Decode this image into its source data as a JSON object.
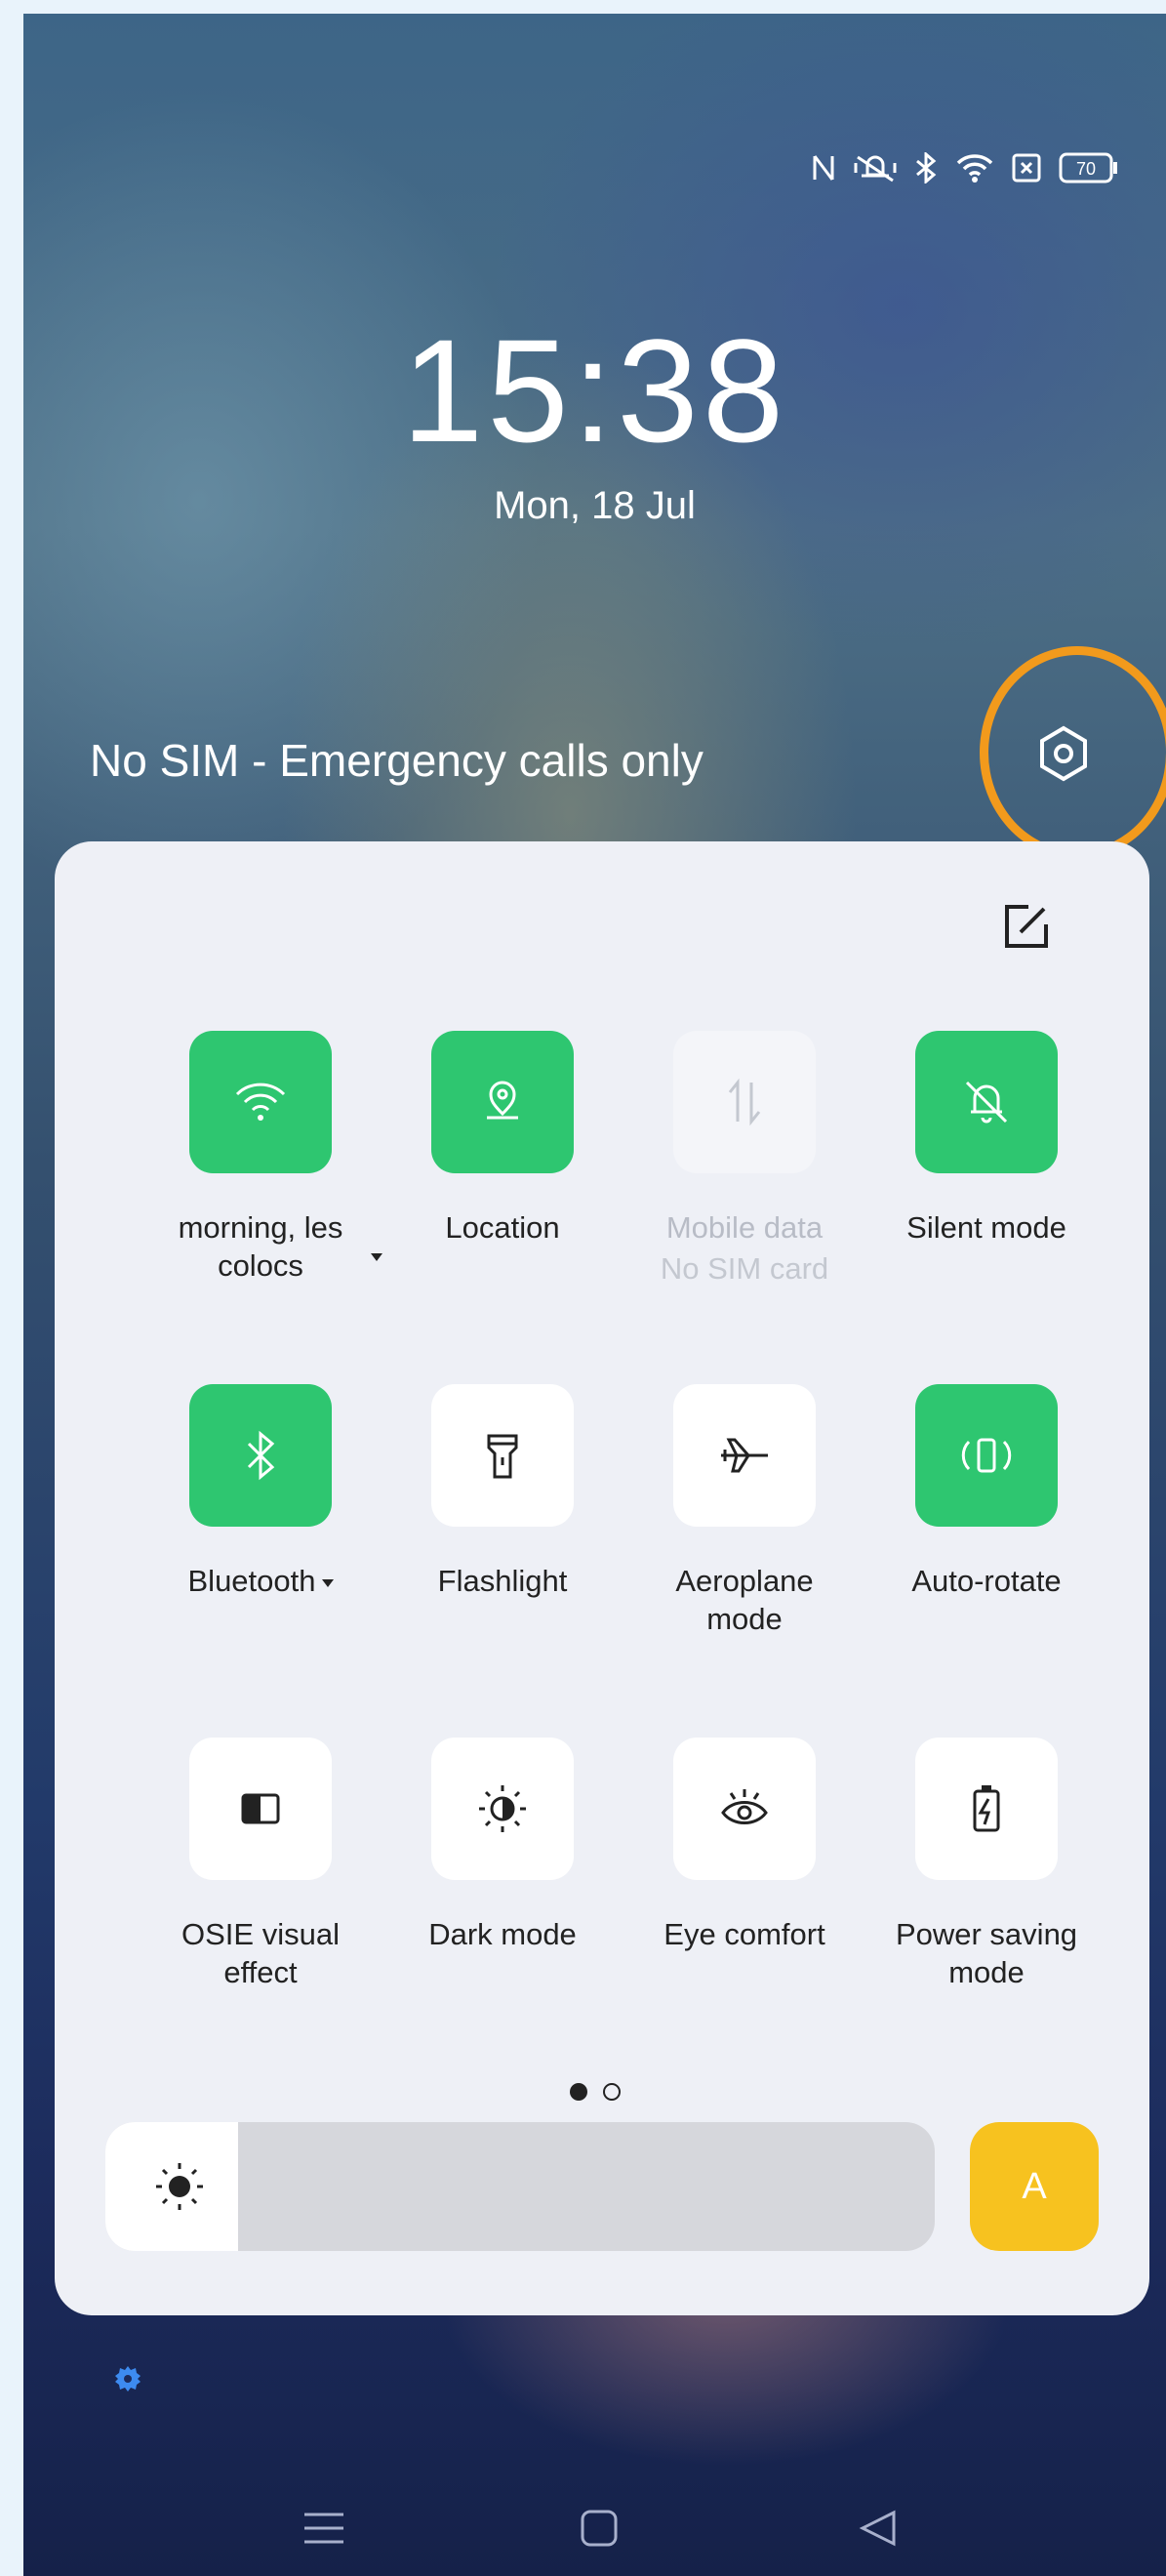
{
  "status_bar": {
    "icons": [
      "nfc-icon",
      "vibrate-icon",
      "bluetooth-icon",
      "wifi-icon",
      "sim-x-icon",
      "battery-icon"
    ],
    "battery_level": "70"
  },
  "lockscreen": {
    "time": "15:38",
    "date": "Mon, 18 Jul",
    "carrier_text": "No SIM - Emergency calls only"
  },
  "quick_settings": {
    "tiles": [
      {
        "id": "wifi",
        "label": "morning, les\ncolocs",
        "icon": "wifi-icon",
        "state": "on",
        "has_caret": true
      },
      {
        "id": "location",
        "label": "Location",
        "icon": "location-pin-icon",
        "state": "on"
      },
      {
        "id": "mobile-data",
        "label": "Mobile data",
        "sub": "No SIM card",
        "icon": "mobile-data-icon",
        "state": "disabled"
      },
      {
        "id": "silent",
        "label": "Silent mode",
        "icon": "bell-off-icon",
        "state": "on"
      },
      {
        "id": "bluetooth",
        "label": "Bluetooth",
        "icon": "bluetooth-icon",
        "state": "on",
        "has_caret": true
      },
      {
        "id": "flashlight",
        "label": "Flashlight",
        "icon": "flashlight-icon",
        "state": "off"
      },
      {
        "id": "aeroplane",
        "label": "Aeroplane\nmode",
        "icon": "airplane-icon",
        "state": "off"
      },
      {
        "id": "auto-rotate",
        "label": "Auto-rotate",
        "icon": "rotate-icon",
        "state": "on"
      },
      {
        "id": "osie",
        "label": "OSIE visual\neffect",
        "icon": "osie-icon",
        "state": "off"
      },
      {
        "id": "dark-mode",
        "label": "Dark mode",
        "icon": "dark-mode-icon",
        "state": "off"
      },
      {
        "id": "eye-comfort",
        "label": "Eye comfort",
        "icon": "eye-icon",
        "state": "off"
      },
      {
        "id": "power-saving",
        "label": "Power saving\nmode",
        "icon": "battery-saver-icon",
        "state": "off"
      }
    ],
    "page_indicator": {
      "pages": 2,
      "current": 1
    },
    "brightness": {
      "level": 0.16,
      "auto_label": "A"
    }
  },
  "colors": {
    "tile_on": "#2ec670",
    "tile_off": "#ffffff",
    "auto_button": "#f7c21f",
    "highlight_ring": "#f29a1c"
  }
}
